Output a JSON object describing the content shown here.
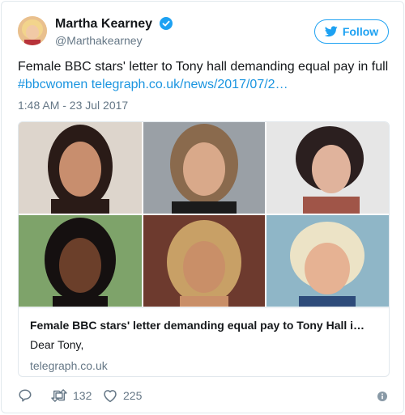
{
  "user": {
    "name": "Martha Kearney",
    "handle": "@Marthakearney"
  },
  "follow_label": "Follow",
  "tweet": {
    "text_before": "Female BBC stars' letter to Tony hall demanding equal pay in full ",
    "hashtag": "#bbcwomen",
    "url": "telegraph.co.uk/news/2017/07/2…",
    "timestamp": "1:48 AM - 23 Jul 2017"
  },
  "card": {
    "title": "Female BBC stars' letter demanding equal pay to Tony Hall i…",
    "description": "Dear Tony,",
    "domain": "telegraph.co.uk"
  },
  "actions": {
    "retweets": "132",
    "likes": "225"
  },
  "colors": {
    "accent": "#1da1f2",
    "link": "#1b95e0",
    "muted": "#657786"
  }
}
